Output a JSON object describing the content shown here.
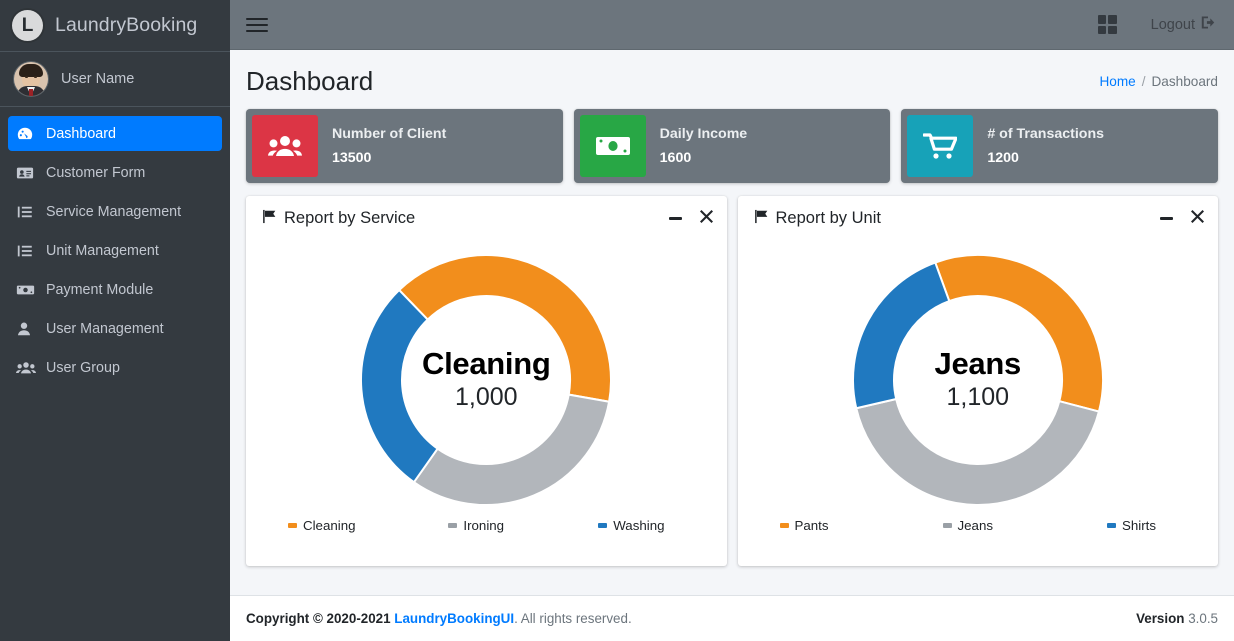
{
  "brand": {
    "logo_letter": "L",
    "title": "LaundryBooking"
  },
  "user_panel": {
    "name": "User Name",
    "avatar_icon": "user-avatar-photo"
  },
  "sidebar": {
    "items": [
      {
        "label": "Dashboard",
        "icon": "tachometer-icon",
        "active": true
      },
      {
        "label": "Customer Form",
        "icon": "id-card-icon",
        "active": false
      },
      {
        "label": "Service Management",
        "icon": "list-icon",
        "active": false
      },
      {
        "label": "Unit Management",
        "icon": "list-icon",
        "active": false
      },
      {
        "label": "Payment Module",
        "icon": "money-bill-icon",
        "active": false
      },
      {
        "label": "User Management",
        "icon": "user-icon",
        "active": false
      },
      {
        "label": "User Group",
        "icon": "users-icon",
        "active": false
      }
    ]
  },
  "topbar": {
    "menu_icon": "hamburger-icon",
    "grid_icon": "th-large-icon",
    "logout_label": "Logout",
    "logout_icon": "sign-out-icon"
  },
  "content_header": {
    "title": "Dashboard",
    "breadcrumb": {
      "home": "Home",
      "separator": "/",
      "current": "Dashboard"
    }
  },
  "stats": [
    {
      "label": "Number of Client",
      "value": "13500",
      "color": "#dc3545",
      "icon": "users-icon"
    },
    {
      "label": "Daily Income",
      "value": "1600",
      "color": "#28a745",
      "icon": "money-bill-icon"
    },
    {
      "label": "# of Transactions",
      "value": "1200",
      "color": "#17a2b8",
      "icon": "shopping-cart-icon"
    }
  ],
  "cards": [
    {
      "title": "Report by Service",
      "flag_icon": "flag-icon",
      "minimize_icon": "minus-icon",
      "close_icon": "times-icon"
    },
    {
      "title": "Report by Unit",
      "flag_icon": "flag-icon",
      "minimize_icon": "minus-icon",
      "close_icon": "times-icon"
    }
  ],
  "chart_data": [
    {
      "type": "pie",
      "variant": "donut",
      "title": "Report by Service",
      "center_label": "Cleaning",
      "center_value": "1,000",
      "labels": [
        "Cleaning",
        "Ironing",
        "Washing"
      ],
      "values": [
        1000,
        800,
        700
      ],
      "colors": [
        "#f28e1c",
        "#b2b6bb",
        "#2079c0"
      ],
      "start_angle_deg": -44,
      "legend_position": "bottom",
      "grid": false
    },
    {
      "type": "pie",
      "variant": "donut",
      "title": "Report by Unit",
      "center_label": "Jeans",
      "center_value": "1,100",
      "labels": [
        "Pants",
        "Jeans",
        "Shirts"
      ],
      "values": [
        900,
        1100,
        600
      ],
      "colors": [
        "#f28e1c",
        "#b2b6bb",
        "#2079c0"
      ],
      "start_angle_deg": -20,
      "legend_position": "bottom",
      "grid": false
    }
  ],
  "footer": {
    "copyright_prefix": "Copyright © 2020-2021 ",
    "brand_link": "LaundryBookingUI",
    "copyright_suffix": ". All rights reserved.",
    "version_label": "Version",
    "version_number": "3.0.5"
  }
}
